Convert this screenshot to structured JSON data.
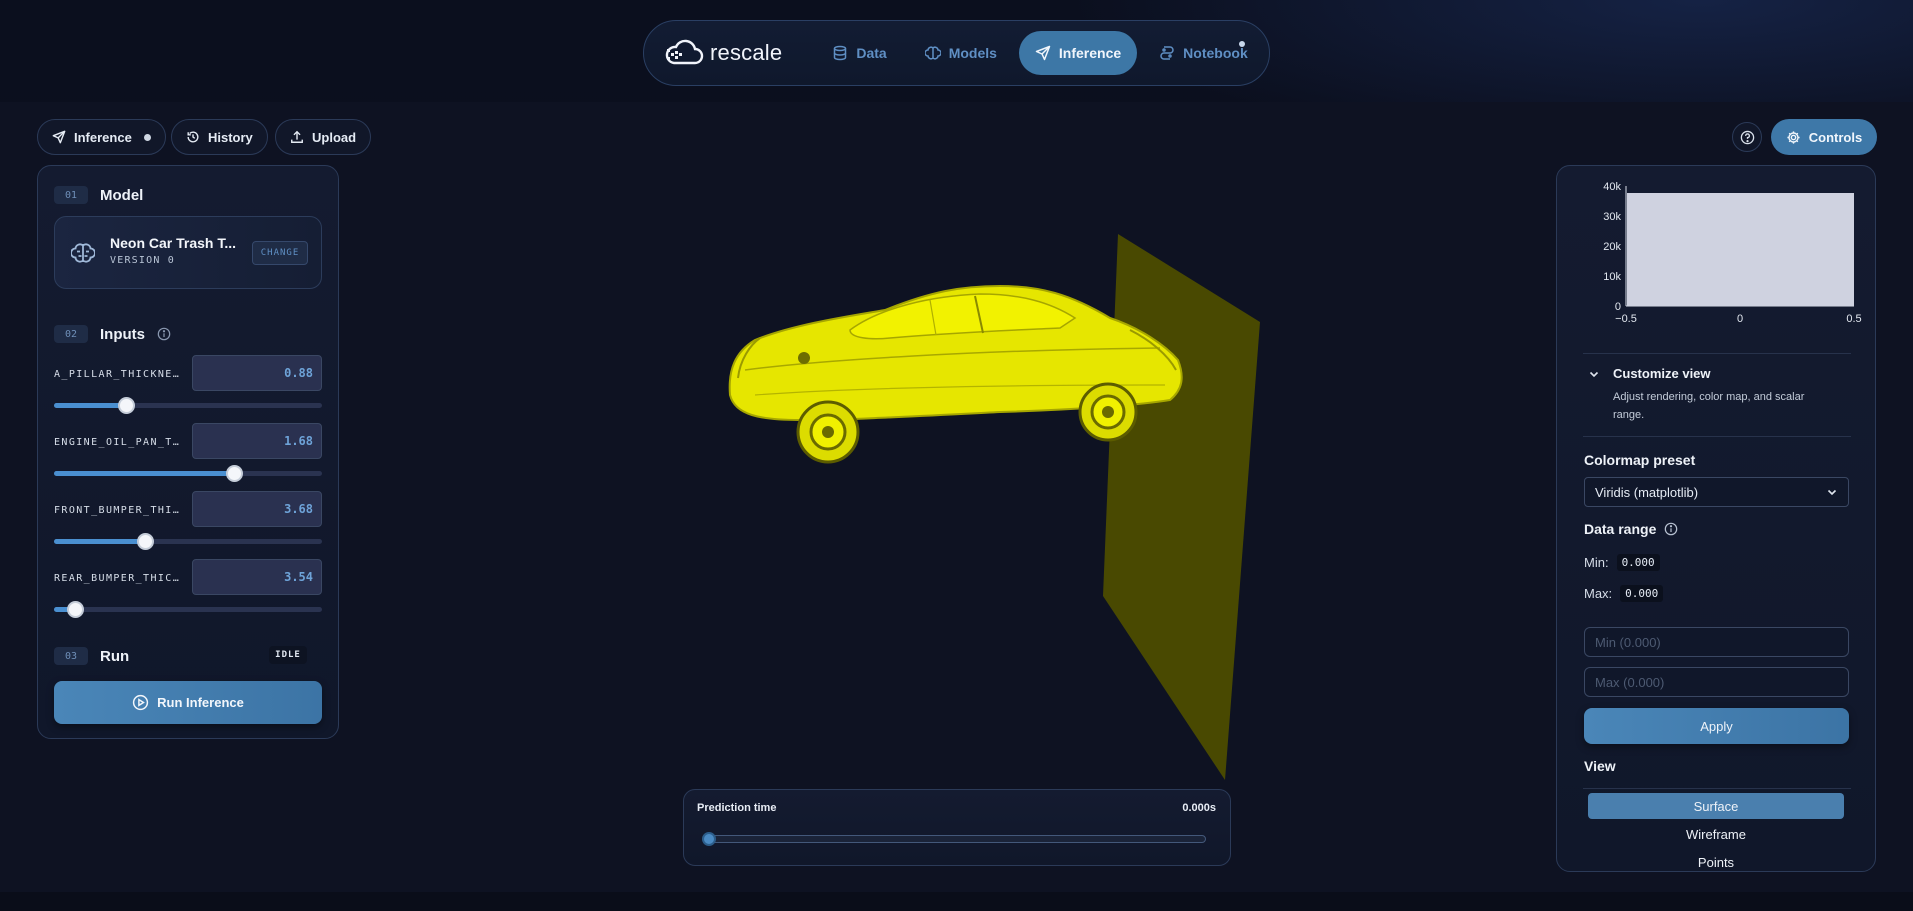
{
  "app": {
    "logo_text": "rescale"
  },
  "nav": {
    "items": [
      {
        "label": "Data",
        "icon": "database-icon"
      },
      {
        "label": "Models",
        "icon": "brain-icon"
      },
      {
        "label": "Inference",
        "icon": "send-icon",
        "active": true
      },
      {
        "label": "Notebook",
        "icon": "notebook-icon"
      }
    ]
  },
  "toolbar": {
    "inference_label": "Inference",
    "history_label": "History",
    "upload_label": "Upload",
    "controls_label": "Controls"
  },
  "model_section": {
    "number": "01",
    "title": "Model",
    "model_name": "Neon Car Trash T...",
    "version": "VERSION 0",
    "change_label": "CHANGE"
  },
  "inputs_section": {
    "number": "02",
    "title": "Inputs",
    "inputs": [
      {
        "label": "A_PILLAR_THICKNE…",
        "value": "0.88",
        "fraction": 0.27
      },
      {
        "label": "ENGINE_OIL_PAN_T…",
        "value": "1.68",
        "fraction": 0.67
      },
      {
        "label": "FRONT_BUMPER_THI…",
        "value": "3.68",
        "fraction": 0.34
      },
      {
        "label": "REAR_BUMPER_THIC…",
        "value": "3.54",
        "fraction": 0.08
      }
    ]
  },
  "run_section": {
    "number": "03",
    "title": "Run",
    "status": "IDLE",
    "run_label": "Run Inference"
  },
  "prediction": {
    "label": "Prediction time",
    "value": "0.000s"
  },
  "histogram": {
    "y_ticks": [
      "40k",
      "30k",
      "20k",
      "10k",
      "0"
    ],
    "x_ticks": [
      "−0.5",
      "0",
      "0.5"
    ],
    "bar_color": "#cfd2e0"
  },
  "customize": {
    "title": "Customize view",
    "description": "Adjust rendering, color map, and scalar range."
  },
  "colormap": {
    "heading": "Colormap preset",
    "selected": "Viridis (matplotlib)"
  },
  "data_range": {
    "heading": "Data range",
    "min_label": "Min:",
    "min_value": "0.000",
    "max_label": "Max:",
    "max_value": "0.000",
    "min_placeholder": "Min (0.000)",
    "max_placeholder": "Max (0.000)",
    "apply_label": "Apply"
  },
  "view": {
    "heading": "View",
    "options": [
      "Surface",
      "Wireframe",
      "Points"
    ],
    "selected": "Surface"
  },
  "colors": {
    "accent": "#3d77a6",
    "model_yellow": "#e6e600",
    "plane_olive": "#4d4d00"
  }
}
